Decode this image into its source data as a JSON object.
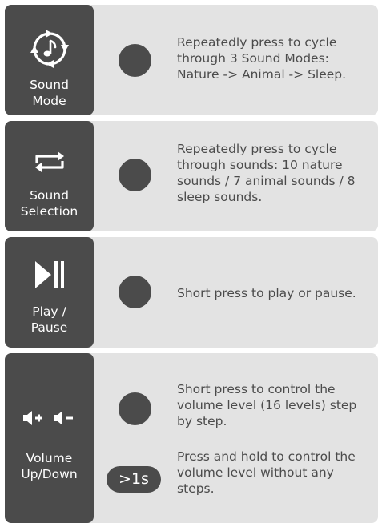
{
  "rows": [
    {
      "icon": "music-note-cycle-icon",
      "label": "Sound\nMode",
      "desc": "Repeatedly press to cycle through 3 Sound Modes: Nature -> Animal -> Sleep."
    },
    {
      "icon": "repeat-icon",
      "label": "Sound\nSelection",
      "desc": "Repeatedly press to cycle through sounds: 10 nature sounds / 7 animal sounds / 8 sleep sounds."
    },
    {
      "icon": "play-pause-icon",
      "label": "Play /\nPause",
      "desc": "Short press to play or pause."
    },
    {
      "icon": "volume-up-down-icon",
      "label": "Volume\nUp/Down",
      "desc_short": "Short press to control the volume level (16 levels) step by step.",
      "hold_badge": ">1s",
      "desc_hold": "Press and hold to control the volume level without any steps."
    }
  ],
  "colors": {
    "tile": "#4b4b4b",
    "card": "#e3e3e3",
    "text": "#4b4b4b"
  }
}
